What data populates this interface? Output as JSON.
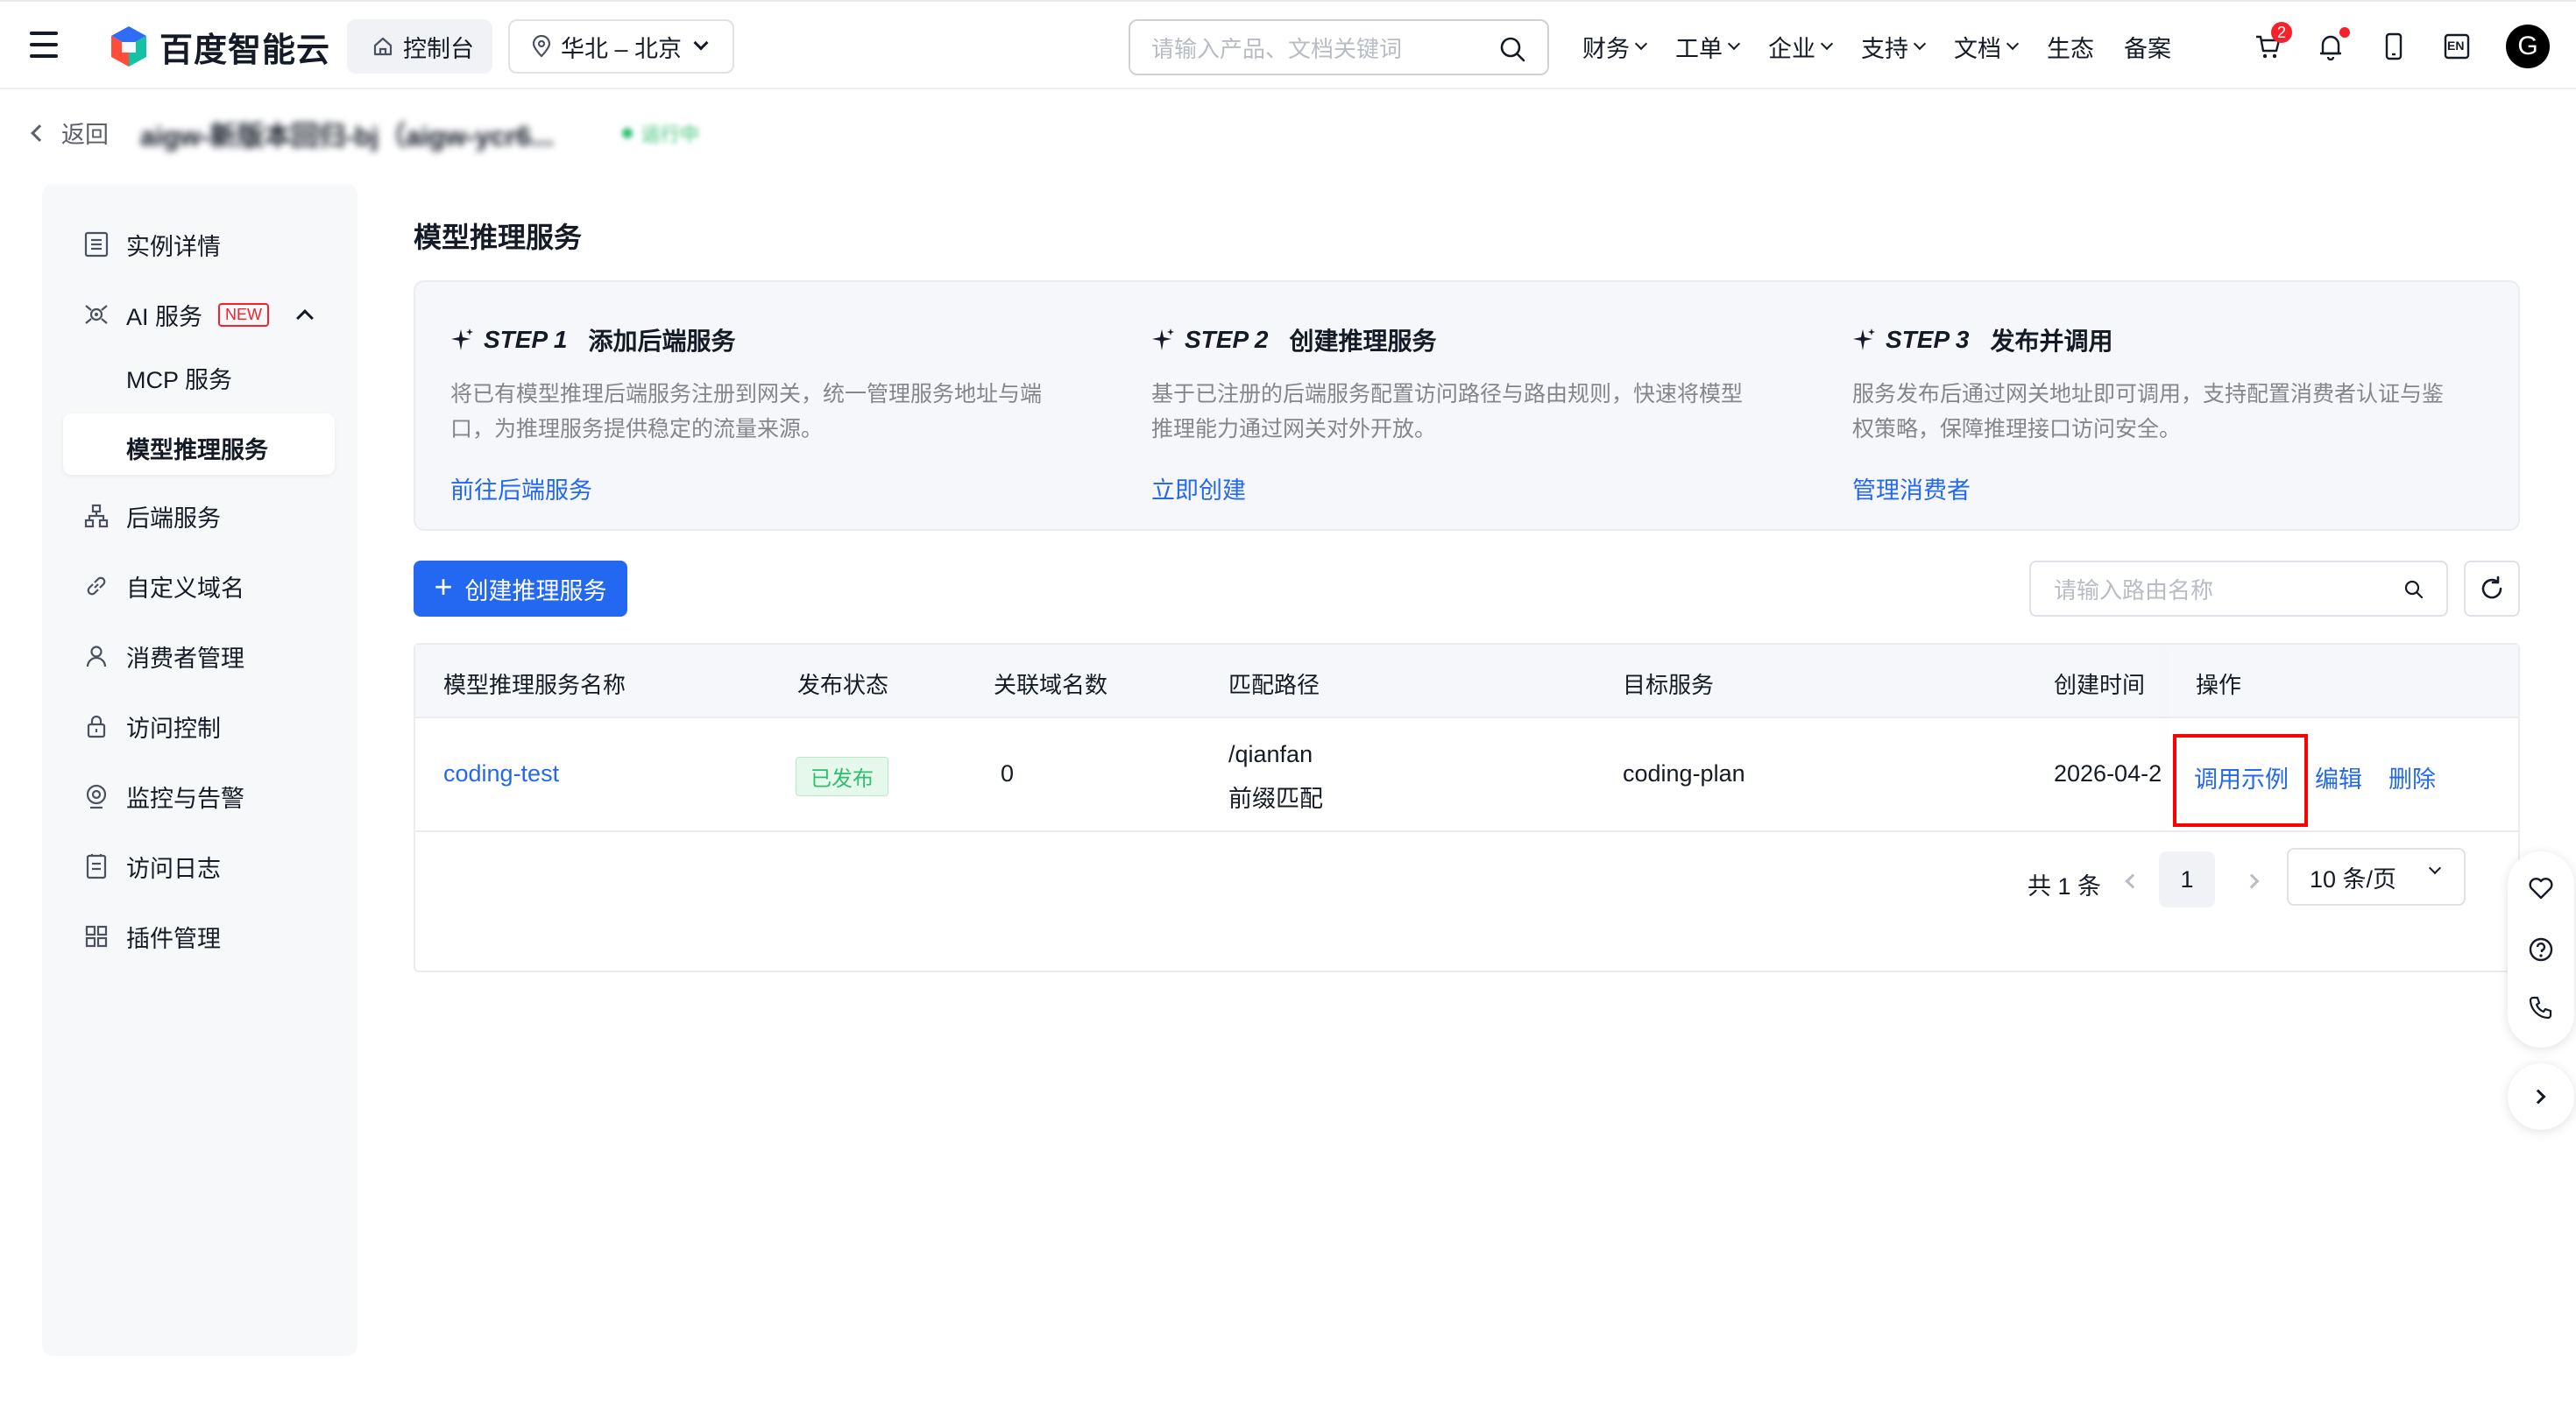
{
  "header": {
    "brand": "百度智能云",
    "console_label": "控制台",
    "region_label": "华北 – 北京",
    "search_placeholder": "请输入产品、文档关键词",
    "nav": [
      "财务",
      "工单",
      "企业",
      "支持",
      "文档",
      "生态",
      "备案"
    ],
    "nav_has_menu": [
      true,
      true,
      true,
      true,
      true,
      false,
      false
    ],
    "cart_badge": "2",
    "lang_label": "EN",
    "avatar_letter": "G"
  },
  "breadcrumb": {
    "back_label": "返回",
    "instance_name": "aigw-新版本回归-bj（aigw-ycr6...",
    "instance_status": "运行中"
  },
  "sidebar": {
    "items": [
      {
        "label": "实例详情",
        "icon": "list-icon"
      },
      {
        "label": "AI 服务",
        "icon": "ai-icon",
        "tag": "NEW",
        "expanded": true
      },
      {
        "label": "MCP 服务",
        "sub": true
      },
      {
        "label": "模型推理服务",
        "sub": true,
        "active": true
      },
      {
        "label": "后端服务",
        "icon": "hierarchy-icon"
      },
      {
        "label": "自定义域名",
        "icon": "link-icon"
      },
      {
        "label": "消费者管理",
        "icon": "user-icon"
      },
      {
        "label": "访问控制",
        "icon": "lock-icon"
      },
      {
        "label": "监控与告警",
        "icon": "monitor-icon"
      },
      {
        "label": "访问日志",
        "icon": "log-icon"
      },
      {
        "label": "插件管理",
        "icon": "grid-icon"
      }
    ]
  },
  "main": {
    "title": "模型推理服务",
    "steps": [
      {
        "num": "STEP 1",
        "title": "添加后端服务",
        "desc1": "将已有模型推理后端服务注册到网关，统一管理服务地址与端",
        "desc2": "口，为推理服务提供稳定的流量来源。",
        "link": "前往后端服务"
      },
      {
        "num": "STEP 2",
        "title": "创建推理服务",
        "desc1": "基于已注册的后端服务配置访问路径与路由规则，快速将模型",
        "desc2": "推理能力通过网关对外开放。",
        "link": "立即创建"
      },
      {
        "num": "STEP 3",
        "title": "发布并调用",
        "desc1": "服务发布后通过网关地址即可调用，支持配置消费者认证与鉴",
        "desc2": "权策略，保障推理接口访问安全。",
        "link": "管理消费者"
      }
    ],
    "create_button": "创建推理服务",
    "route_search_placeholder": "请输入路由名称",
    "table": {
      "columns": [
        "模型推理服务名称",
        "发布状态",
        "关联域名数",
        "匹配路径",
        "目标服务",
        "创建时间",
        "操作"
      ],
      "rows": [
        {
          "name": "coding-test",
          "status": "已发布",
          "domain_count": "0",
          "path": "/qianfan",
          "match_type": "前缀匹配",
          "target": "coding-plan",
          "created": "2026-04-2",
          "actions": [
            "调用示例",
            "编辑",
            "删除"
          ]
        }
      ]
    },
    "pagination": {
      "total": "共 1 条",
      "current": "1",
      "page_size": "10 条/页"
    }
  },
  "colors": {
    "primary": "#2468f2",
    "success": "#30bf6f",
    "danger": "#f5222d",
    "highlight_box": "#ff0000"
  }
}
